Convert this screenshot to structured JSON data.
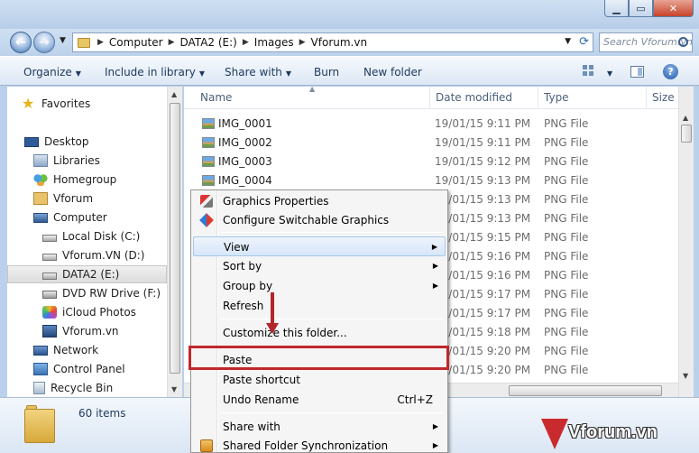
{
  "address": {
    "crumbs": [
      "Computer",
      "DATA2 (E:)",
      "Images",
      "Vforum.vn"
    ]
  },
  "search": {
    "placeholder": "Search Vforum.vn"
  },
  "toolbar": {
    "organize": "Organize",
    "include": "Include in library",
    "share": "Share with",
    "burn": "Burn",
    "new_folder": "New folder"
  },
  "sidebar": {
    "items": [
      {
        "label": "Favorites",
        "icon": "star-icon"
      },
      {
        "label": "Desktop",
        "icon": "desktop-icon"
      },
      {
        "label": "Libraries",
        "icon": "libraries-icon"
      },
      {
        "label": "Homegroup",
        "icon": "homegroup-icon"
      },
      {
        "label": "Vforum",
        "icon": "user-folder-icon"
      },
      {
        "label": "Computer",
        "icon": "computer-icon"
      },
      {
        "label": "Local Disk (C:)",
        "icon": "disk-icon"
      },
      {
        "label": "Vforum.VN (D:)",
        "icon": "disk-icon"
      },
      {
        "label": "DATA2 (E:)",
        "icon": "disk-icon"
      },
      {
        "label": "DVD RW Drive (F:)",
        "icon": "dvd-icon"
      },
      {
        "label": "iCloud Photos",
        "icon": "icloud-icon"
      },
      {
        "label": "Vforum.vn",
        "icon": "vforum-icon"
      },
      {
        "label": "Network",
        "icon": "network-icon"
      },
      {
        "label": "Control Panel",
        "icon": "control-panel-icon"
      },
      {
        "label": "Recycle Bin",
        "icon": "recycle-bin-icon"
      }
    ],
    "selected": "DATA2 (E:)"
  },
  "columns": {
    "name": "Name",
    "date": "Date modified",
    "type": "Type",
    "size": "Size"
  },
  "files": [
    {
      "name": "IMG_0001",
      "date": "19/01/15 9:11 PM",
      "type": "PNG File"
    },
    {
      "name": "IMG_0002",
      "date": "19/01/15 9:11 PM",
      "type": "PNG File"
    },
    {
      "name": "IMG_0003",
      "date": "19/01/15 9:12 PM",
      "type": "PNG File"
    },
    {
      "name": "IMG_0004",
      "date": "19/01/15 9:13 PM",
      "type": "PNG File"
    },
    {
      "name": "",
      "date": "19/01/15 9:13 PM",
      "type": "PNG File"
    },
    {
      "name": "",
      "date": "19/01/15 9:13 PM",
      "type": "PNG File"
    },
    {
      "name": "",
      "date": "19/01/15 9:15 PM",
      "type": "PNG File"
    },
    {
      "name": "",
      "date": "19/01/15 9:16 PM",
      "type": "PNG File"
    },
    {
      "name": "",
      "date": "19/01/15 9:16 PM",
      "type": "PNG File"
    },
    {
      "name": "",
      "date": "19/01/15 9:17 PM",
      "type": "PNG File"
    },
    {
      "name": "",
      "date": "19/01/15 9:17 PM",
      "type": "PNG File"
    },
    {
      "name": "",
      "date": "19/01/15 9:18 PM",
      "type": "PNG File"
    },
    {
      "name": "",
      "date": "19/01/15 9:20 PM",
      "type": "PNG File"
    },
    {
      "name": "",
      "date": "19/01/15 9:20 PM",
      "type": "PNG File"
    }
  ],
  "details": {
    "item_count": "60 items"
  },
  "context_menu": {
    "graphics_properties": "Graphics Properties",
    "switchable_graphics": "Configure Switchable Graphics",
    "view": "View",
    "sort_by": "Sort by",
    "group_by": "Group by",
    "refresh": "Refresh",
    "customize": "Customize this folder...",
    "paste": "Paste",
    "paste_shortcut": "Paste shortcut",
    "undo_rename": "Undo Rename",
    "undo_shortcut": "Ctrl+Z",
    "share_with": "Share with",
    "shared_sync": "Shared Folder Synchronization"
  },
  "watermark": {
    "text": "Vforum.vn"
  },
  "colors": {
    "highlight_box": "#c0272d",
    "arrow": "#b3262b"
  }
}
